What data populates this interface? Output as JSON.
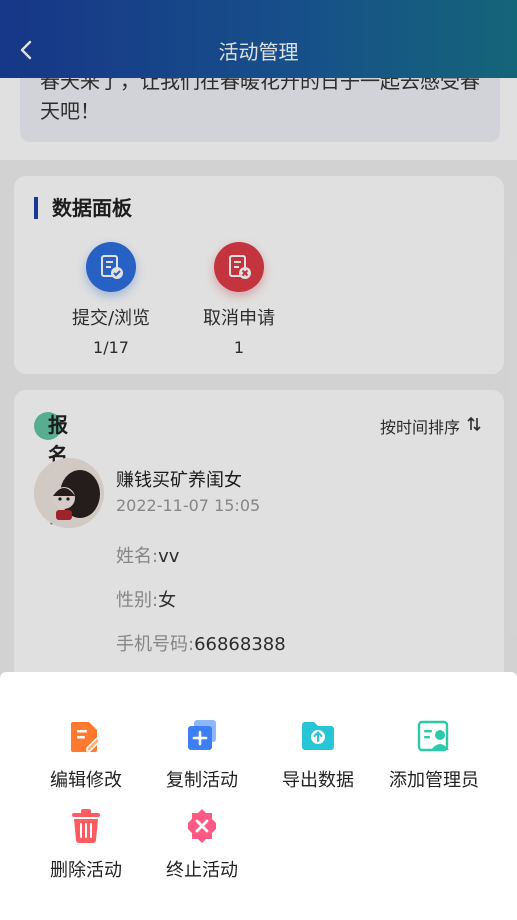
{
  "header": {
    "title": "活动管理"
  },
  "intro": {
    "text": "春天来了，让我们在春暖花开的日子一起去感受春天吧！"
  },
  "panel": {
    "title": "数据面板",
    "stats": [
      {
        "label": "提交/浏览",
        "count": "1/17",
        "icon": "document-check-icon",
        "color": "#2e6fe0"
      },
      {
        "label": "取消申请",
        "count": "1",
        "icon": "document-cancel-icon",
        "color": "#e03c48"
      }
    ]
  },
  "detail": {
    "title": "报名详情",
    "sort_label": "按时间排序",
    "entry": {
      "nickname": "赚钱买矿养闺女",
      "time": "2022-11-07 15:05",
      "name_label": "姓名:",
      "name_value": "vv",
      "gender_label": "性别:",
      "gender_value": "女",
      "phone_label": "手机号码:",
      "phone_value": "66868388"
    }
  },
  "actions": [
    {
      "label": "编辑修改",
      "icon": "edit-icon",
      "color": "#ff7a2f"
    },
    {
      "label": "复制活动",
      "icon": "copy-icon",
      "color": "#3d7ff2"
    },
    {
      "label": "导出数据",
      "icon": "export-folder-icon",
      "color": "#26c6d6"
    },
    {
      "label": "添加管理员",
      "icon": "add-admin-icon",
      "color": "#2ec9a8"
    },
    {
      "label": "删除活动",
      "icon": "trash-icon",
      "color": "#ff5c62"
    },
    {
      "label": "终止活动",
      "icon": "stop-icon",
      "color": "#ff5a86"
    }
  ]
}
